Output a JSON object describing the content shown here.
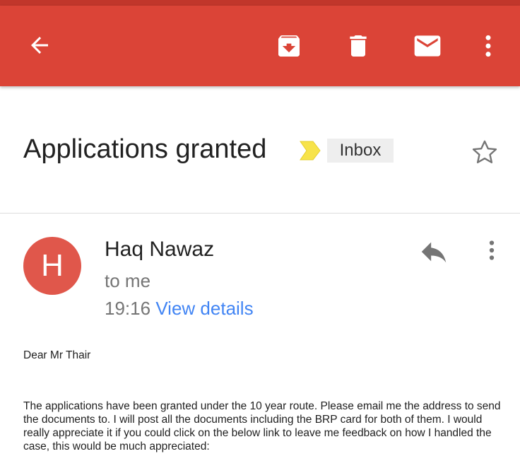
{
  "toolbar": {
    "back_icon": "arrow-back-icon",
    "archive_icon": "archive-icon",
    "delete_icon": "trash-icon",
    "mark_unread_icon": "mail-icon",
    "more_icon": "more-vert-icon",
    "color": "#db4437"
  },
  "email": {
    "subject": "Applications granted",
    "label": "Inbox",
    "importance_marker_color": "#f7e34a",
    "sender_initial": "H",
    "sender_name": "Haq Nawaz",
    "recipient": "to me",
    "time": "19:16",
    "view_details": "View details",
    "greeting": "Dear Mr Thair",
    "body": "The applications have been granted under the 10 year route. Please email me the address to send the documents to. I will post all the documents including the BRP card for both of them. I would really appreciate it if you could click on the below link to leave me feedback on how I handled the case, this would be much appreciated:"
  }
}
